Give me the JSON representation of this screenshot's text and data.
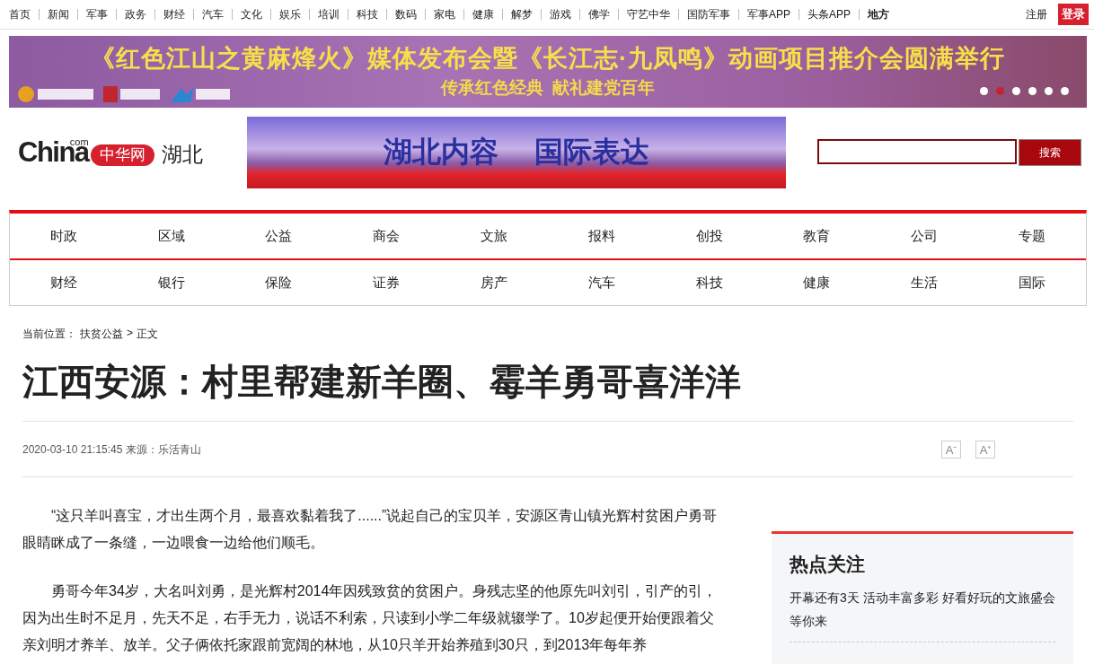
{
  "top_nav": {
    "items": [
      {
        "label": "首页",
        "bold": false
      },
      {
        "label": "新闻",
        "bold": false
      },
      {
        "label": "军事",
        "bold": false
      },
      {
        "label": "政务",
        "bold": false
      },
      {
        "label": "财经",
        "bold": false
      },
      {
        "label": "汽车",
        "bold": false
      },
      {
        "label": "文化",
        "bold": false
      },
      {
        "label": "娱乐",
        "bold": false
      },
      {
        "label": "培训",
        "bold": false
      },
      {
        "label": "科技",
        "bold": false
      },
      {
        "label": "数码",
        "bold": false
      },
      {
        "label": "家电",
        "bold": false
      },
      {
        "label": "健康",
        "bold": false
      },
      {
        "label": "解梦",
        "bold": false
      },
      {
        "label": "游戏",
        "bold": false
      },
      {
        "label": "佛学",
        "bold": false
      },
      {
        "label": "守艺中华",
        "bold": false
      },
      {
        "label": "国防军事",
        "bold": false
      },
      {
        "label": "军事APP",
        "bold": false
      },
      {
        "label": "头条APP",
        "bold": false
      },
      {
        "label": "地方",
        "bold": true
      }
    ],
    "register": "注册",
    "login": "登录"
  },
  "top_banner": {
    "headline": "《红色江山之黄麻烽火》媒体发布会暨《长江志·九凤鸣》动画项目推介会圆满举行",
    "subtitle": "传承红色经典  献礼建党百年",
    "dots": [
      {
        "selected": false
      },
      {
        "selected": true
      },
      {
        "selected": false
      },
      {
        "selected": false
      },
      {
        "selected": false
      },
      {
        "selected": false
      }
    ]
  },
  "header": {
    "logo_com": "com",
    "logo_china": "China",
    "logo_cn": "中华网",
    "region": "湖北",
    "banner_texts": [
      "湖北内容",
      "国际表达"
    ],
    "search_button": "搜索"
  },
  "nav_rows": [
    [
      "时政",
      "区域",
      "公益",
      "商会",
      "文旅",
      "报料",
      "创投",
      "教育",
      "公司",
      "专题"
    ],
    [
      "财经",
      "银行",
      "保险",
      "证券",
      "房产",
      "汽车",
      "科技",
      "健康",
      "生活",
      "国际"
    ]
  ],
  "breadcrumb": {
    "label": "当前位置：",
    "section": "扶贫公益",
    "separator": ">",
    "current": "正文"
  },
  "article": {
    "title": "江西安源：村里帮建新羊圈、霉羊勇哥喜洋洋",
    "meta": "2020-03-10 21:15:45 来源：乐活青山",
    "font_buttons": [
      "A⁻",
      "A⁺"
    ],
    "paragraphs": [
      "“这只羊叫喜宝，才出生两个月，最喜欢黏着我了......”说起自己的宝贝羊，安源区青山镇光辉村贫困户勇哥眼睛眯成了一条缝，一边喂食一边给他们顺毛。",
      "勇哥今年34岁，大名叫刘勇，是光辉村2014年因残致贫的贫困户。身残志坚的他原先叫刘引，引产的引，因为出生时不足月，先天不足，右手无力，说话不利索，只读到小学二年级就辍学了。10岁起便开始便跟着父亲刘明才养羊、放羊。父子俩依托家跟前宽阔的林地，从10只羊开始养殖到30只，到2013年每年养"
    ]
  },
  "sidebar": {
    "title": "热点关注",
    "items": [
      "开幕还有3天 活动丰富多彩 好看好玩的文旅盛会等你来"
    ]
  }
}
